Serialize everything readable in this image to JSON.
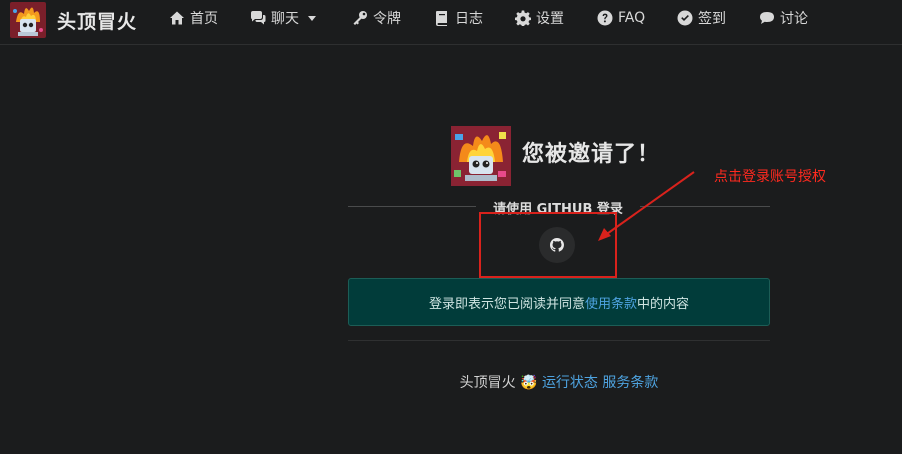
{
  "brand": {
    "name": "头顶冒火"
  },
  "nav": [
    {
      "label": "首页",
      "icon": "home-icon"
    },
    {
      "label": "聊天",
      "icon": "chat-icon",
      "dropdown": true
    },
    {
      "label": "令牌",
      "icon": "key-icon"
    },
    {
      "label": "日志",
      "icon": "book-icon"
    },
    {
      "label": "设置",
      "icon": "gear-icon"
    },
    {
      "label": "FAQ",
      "icon": "question-circle-icon"
    },
    {
      "label": "签到",
      "icon": "check-circle-icon"
    },
    {
      "label": "讨论",
      "icon": "comment-icon"
    }
  ],
  "invite": {
    "title": "您被邀请了！",
    "divider_text": "请使用 GITHUB 登录",
    "github_icon": "github-icon",
    "terms_prefix": "登录即表示您已阅读并同意",
    "terms_link": "使用条款",
    "terms_suffix": "中的内容"
  },
  "footer": {
    "brand": "头顶冒火",
    "emoji": "🤯",
    "status_link": "运行状态",
    "terms_link": "服务条款"
  },
  "annotation": {
    "text": "点击登录账号授权",
    "color": "#ff2a1f"
  },
  "colors": {
    "background": "#1b1c1d",
    "terms_bg": "#013c3a",
    "link": "#4ea3e0"
  }
}
